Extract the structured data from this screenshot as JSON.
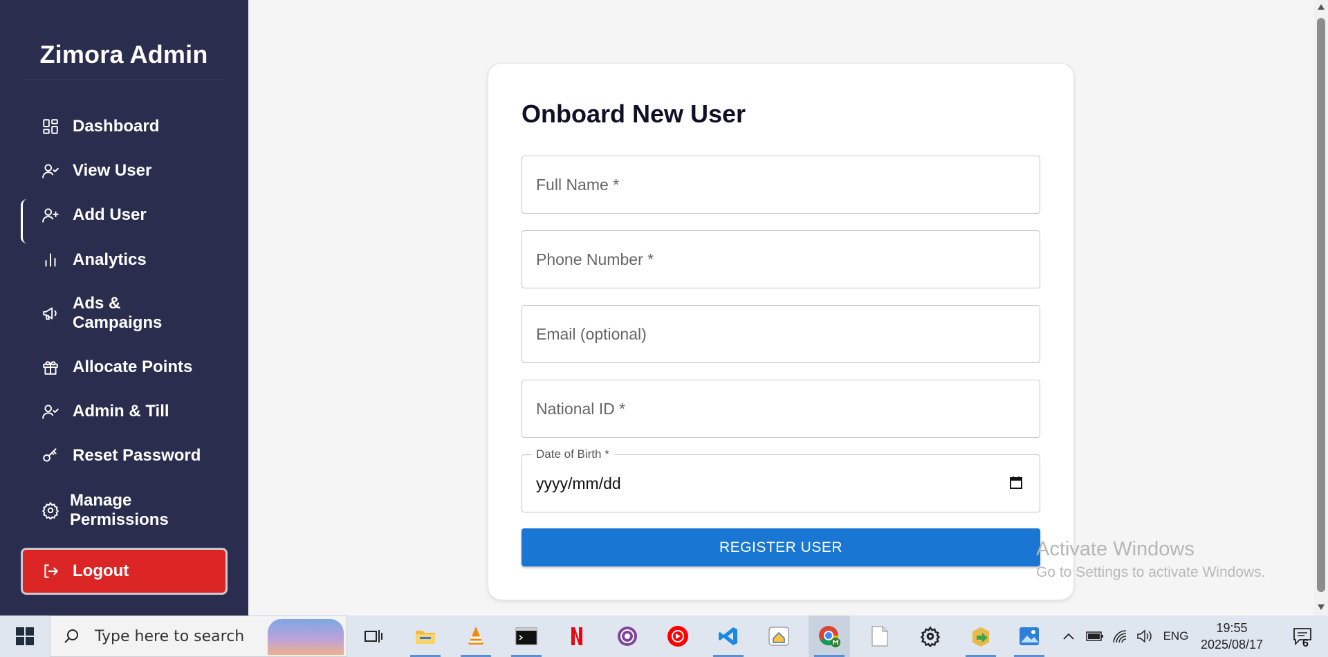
{
  "sidebar": {
    "brand": "Zimora Admin",
    "items": [
      {
        "label": "Dashboard",
        "icon": "dashboard-icon"
      },
      {
        "label": "View User",
        "icon": "user-check-icon"
      },
      {
        "label": "Add User",
        "icon": "user-plus-icon",
        "active": true
      },
      {
        "label": "Analytics",
        "icon": "bar-chart-icon"
      },
      {
        "label": "Ads & Campaigns",
        "icon": "megaphone-icon"
      },
      {
        "label": "Allocate Points",
        "icon": "gift-icon"
      },
      {
        "label": "Admin & Till",
        "icon": "user-check-icon"
      },
      {
        "label": "Reset Password",
        "icon": "key-icon"
      },
      {
        "label": "Manage Permissions",
        "icon": "gear-icon"
      }
    ],
    "logout_label": "Logout"
  },
  "form": {
    "title": "Onboard New User",
    "full_name_placeholder": "Full Name *",
    "phone_placeholder": "Phone Number *",
    "email_placeholder": "Email (optional)",
    "national_id_placeholder": "National ID *",
    "dob_label": "Date of Birth *",
    "dob_value": "yyyy/mm/dd",
    "submit_label": "REGISTER USER"
  },
  "watermark": {
    "line1": "Activate Windows",
    "line2": "Go to Settings to activate Windows."
  },
  "taskbar": {
    "search_placeholder": "Type here to search",
    "language": "ENG",
    "time": "19:55",
    "date": "2025/08/17",
    "notification_count": "6"
  },
  "colors": {
    "sidebar_bg": "#2a2d4e",
    "logout_bg": "#dc2626",
    "primary_button": "#1976d2"
  }
}
